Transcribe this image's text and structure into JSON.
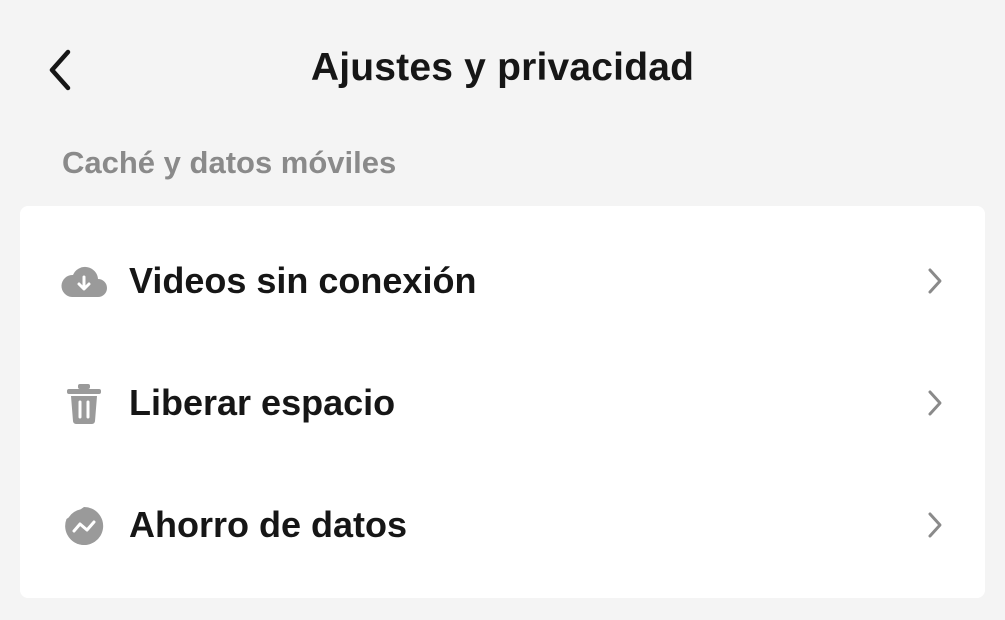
{
  "header": {
    "title": "Ajustes y privacidad",
    "back_icon": "chevron-left-icon"
  },
  "section": {
    "title": "Caché y datos móviles"
  },
  "items": [
    {
      "label": "Videos sin conexión",
      "icon": "cloud-download-icon"
    },
    {
      "label": "Liberar espacio",
      "icon": "trash-icon"
    },
    {
      "label": "Ahorro de datos",
      "icon": "data-saver-icon"
    }
  ],
  "colors": {
    "background": "#f4f4f4",
    "card": "#ffffff",
    "text_primary": "#161616",
    "text_secondary": "#8a8a8a",
    "icon_gray": "#9a9a9a"
  }
}
